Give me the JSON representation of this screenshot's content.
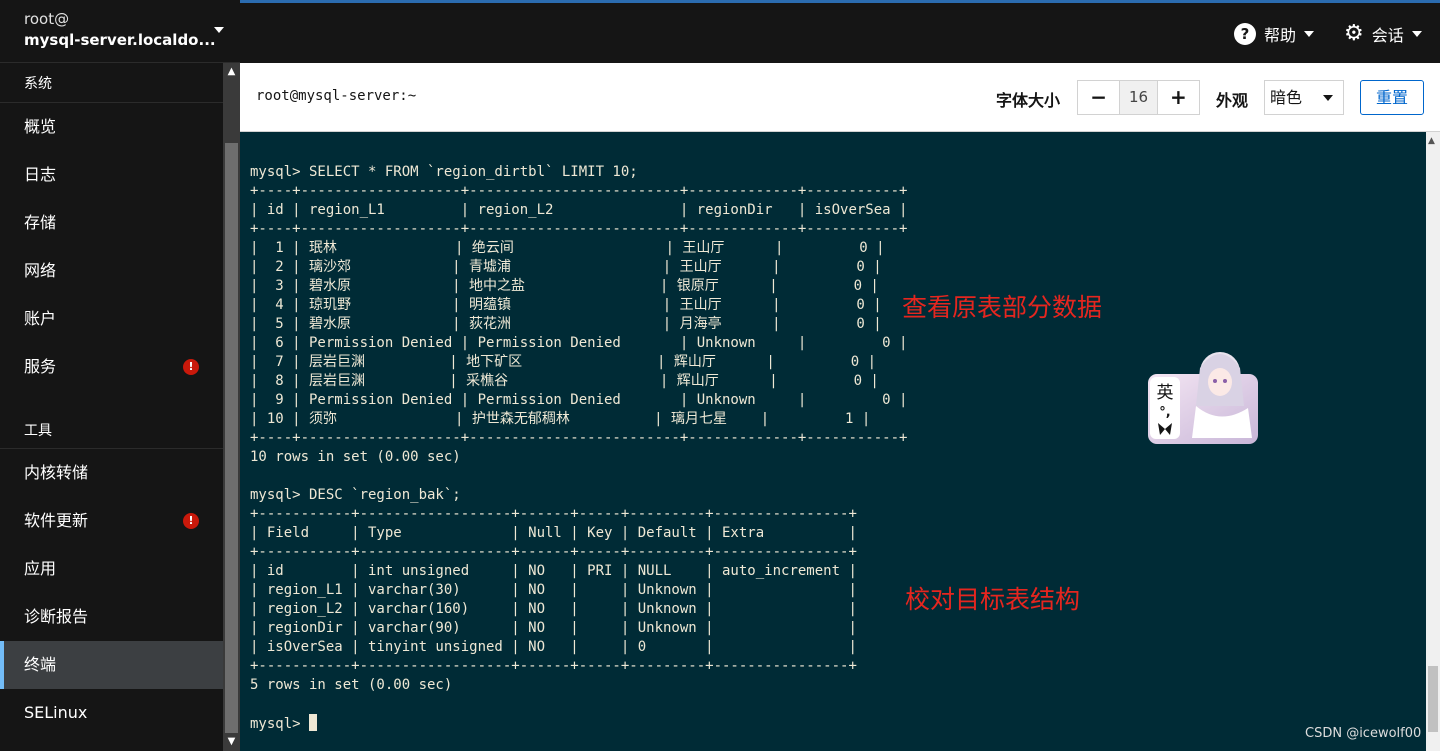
{
  "host": {
    "user": "root@",
    "name": "mysql-server.localdo..."
  },
  "nav": {
    "group_system": "系统",
    "items_system": [
      {
        "label": "概览",
        "alert": false
      },
      {
        "label": "日志",
        "alert": false
      },
      {
        "label": "存储",
        "alert": false
      },
      {
        "label": "网络",
        "alert": false
      },
      {
        "label": "账户",
        "alert": false
      },
      {
        "label": "服务",
        "alert": true
      }
    ],
    "group_tools": "工具",
    "items_tools": [
      {
        "label": "内核转储",
        "alert": false
      },
      {
        "label": "软件更新",
        "alert": true
      },
      {
        "label": "应用",
        "alert": false
      },
      {
        "label": "诊断报告",
        "alert": false
      },
      {
        "label": "终端",
        "alert": false,
        "active": true
      },
      {
        "label": "SELinux",
        "alert": false
      }
    ],
    "alert_glyph": "!"
  },
  "topbar": {
    "help_label": "帮助",
    "session_label": "会话",
    "help_glyph": "?",
    "gear_glyph": "⚙"
  },
  "toolbar": {
    "title": "root@mysql-server:~",
    "font_size_label": "字体大小",
    "font_minus": "−",
    "font_value": "16",
    "font_plus": "+",
    "appearance_label": "外观",
    "appearance_value": "暗色",
    "reset_label": "重置"
  },
  "terminal": {
    "lines": [
      "mysql> SELECT * FROM `region_dirtbl` LIMIT 10;",
      "+----+-------------------+-------------------------+-------------+-----------+",
      "| id | region_L1         | region_L2               | regionDir   | isOverSea |",
      "+----+-------------------+-------------------------+-------------+-----------+",
      "|  1 | 珉林              | 绝云间                  | 王山厅      |         0 |",
      "|  2 | 璃沙郊            | 青墟浦                  | 王山厅      |         0 |",
      "|  3 | 碧水原            | 地中之盐                | 银原厅      |         0 |",
      "|  4 | 琼玑野            | 明蕴镇                  | 王山厅      |         0 |",
      "|  5 | 碧水原            | 荻花洲                  | 月海亭      |         0 |",
      "|  6 | Permission Denied | Permission Denied       | Unknown     |         0 |",
      "|  7 | 层岩巨渊          | 地下矿区                | 辉山厅      |         0 |",
      "|  8 | 层岩巨渊          | 采樵谷                  | 辉山厅      |         0 |",
      "|  9 | Permission Denied | Permission Denied       | Unknown     |         0 |",
      "| 10 | 须弥              | 护世森无郁稠林          | 璃月七星    |         1 |",
      "+----+-------------------+-------------------------+-------------+-----------+",
      "10 rows in set (0.00 sec)",
      "",
      "mysql> DESC `region_bak`;",
      "+-----------+------------------+------+-----+---------+----------------+",
      "| Field     | Type             | Null | Key | Default | Extra          |",
      "+-----------+------------------+------+-----+---------+----------------+",
      "| id        | int unsigned     | NO   | PRI | NULL    | auto_increment |",
      "| region_L1 | varchar(30)      | NO   |     | Unknown |                |",
      "| region_L2 | varchar(160)     | NO   |     | Unknown |                |",
      "| regionDir | varchar(90)      | NO   |     | Unknown |                |",
      "| isOverSea | tinyint unsigned | NO   |     | 0       |                |",
      "+-----------+------------------+------+-----+---------+----------------+",
      "5 rows in set (0.00 sec)",
      ""
    ],
    "prompt": "mysql> "
  },
  "annotations": {
    "first": "查看原表部分数据",
    "second": "校对目标表结构"
  },
  "ime_badge": {
    "char": "英",
    "punct": "°,",
    "icon": "butterfly-icon"
  },
  "watermark": "CSDN @icewolf00"
}
